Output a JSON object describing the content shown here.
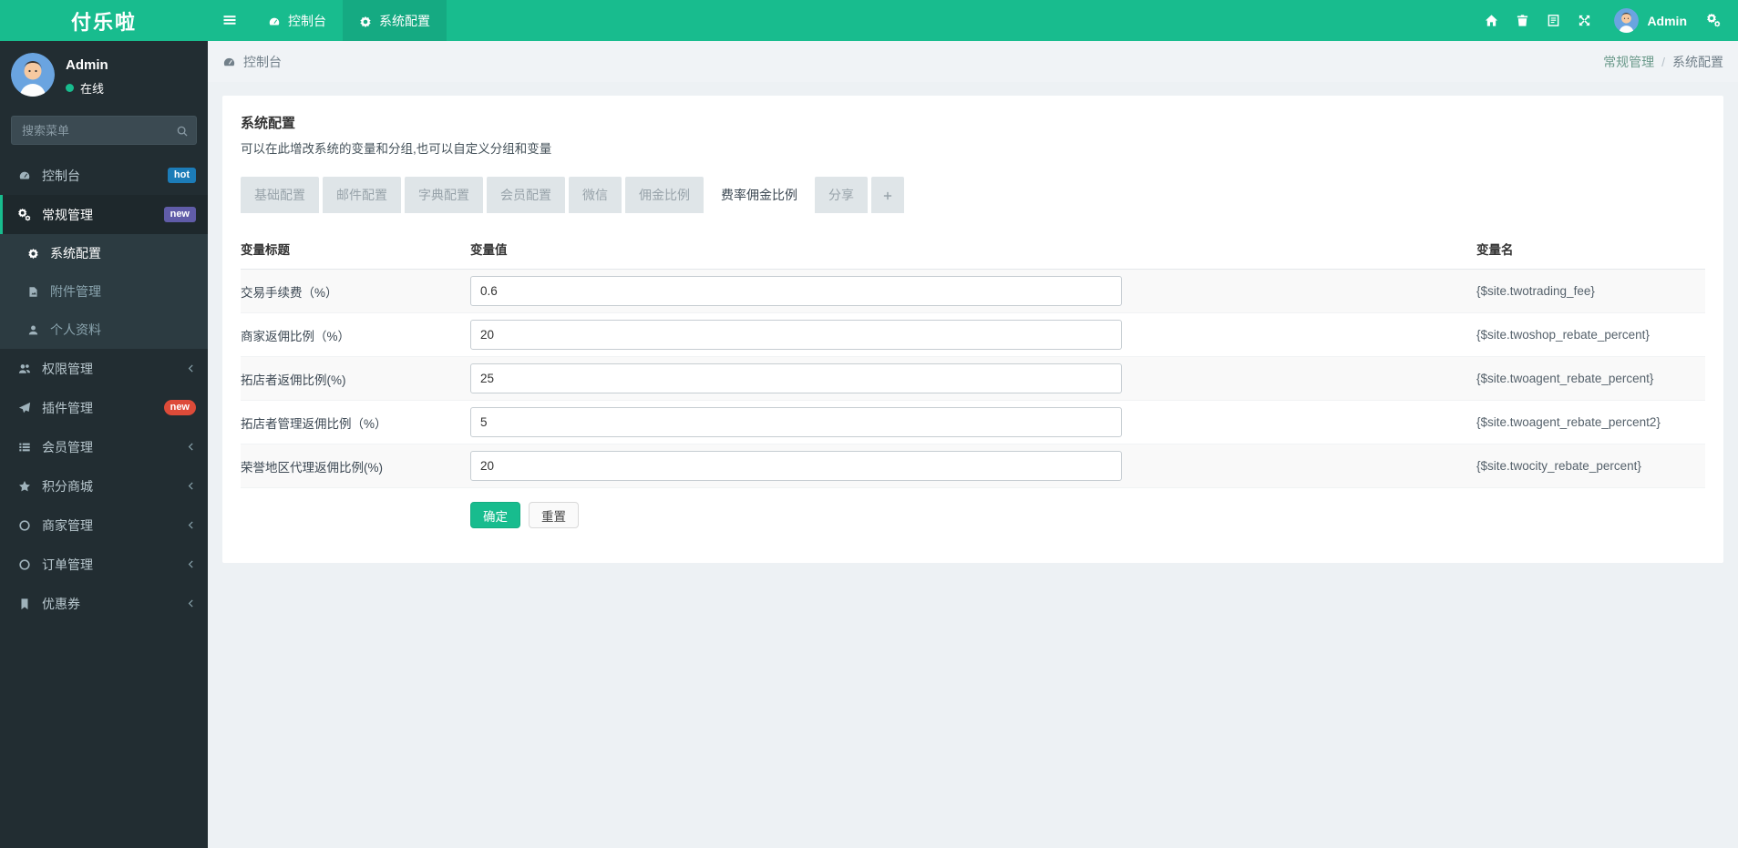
{
  "app": {
    "logo": "付乐啦"
  },
  "topnav": {
    "items": [
      {
        "label": "控制台",
        "icon": "tachometer",
        "active": false
      },
      {
        "label": "系统配置",
        "icon": "gear",
        "active": true
      }
    ],
    "right_icons": [
      {
        "name": "home-icon",
        "icon": "home"
      },
      {
        "name": "trash-icon",
        "icon": "trash"
      },
      {
        "name": "manual-icon",
        "icon": "book"
      },
      {
        "name": "fullscreen-icon",
        "icon": "expand"
      }
    ],
    "user": {
      "name": "Admin"
    },
    "after_user_icon": {
      "name": "cogs-icon",
      "icon": "cogs"
    }
  },
  "sidebar": {
    "user": {
      "name": "Admin",
      "status": "在线"
    },
    "search_placeholder": "搜索菜单",
    "items": [
      {
        "label": "控制台",
        "icon": "tachometer",
        "badge": {
          "text": "hot",
          "type": "blue"
        }
      },
      {
        "label": "常规管理",
        "icon": "cogs",
        "badge": {
          "text": "new",
          "type": "purple"
        },
        "active": true,
        "children": [
          {
            "label": "系统配置",
            "icon": "gear",
            "active": true
          },
          {
            "label": "附件管理",
            "icon": "file"
          },
          {
            "label": "个人资料",
            "icon": "user"
          }
        ]
      },
      {
        "label": "权限管理",
        "icon": "users",
        "chevron": true
      },
      {
        "label": "插件管理",
        "icon": "plane",
        "badge": {
          "text": "new",
          "type": "red"
        }
      },
      {
        "label": "会员管理",
        "icon": "list",
        "chevron": true
      },
      {
        "label": "积分商城",
        "icon": "star",
        "chevron": true
      },
      {
        "label": "商家管理",
        "icon": "circle",
        "chevron": true
      },
      {
        "label": "订单管理",
        "icon": "circle",
        "chevron": true
      },
      {
        "label": "优惠券",
        "icon": "bookmark",
        "chevron": true
      }
    ]
  },
  "breadcrumb": {
    "left": "控制台",
    "section": "常规管理",
    "separator": "/",
    "page": "系统配置"
  },
  "panel": {
    "title": "系统配置",
    "subtitle": "可以在此增改系统的变量和分组,也可以自定义分组和变量",
    "tabs": [
      {
        "label": "基础配置"
      },
      {
        "label": "邮件配置"
      },
      {
        "label": "字典配置"
      },
      {
        "label": "会员配置"
      },
      {
        "label": "微信"
      },
      {
        "label": "佣金比例"
      },
      {
        "label": "费率佣金比例",
        "active": true
      },
      {
        "label": "分享"
      },
      {
        "label": "+",
        "is_add": true
      }
    ],
    "table": {
      "headers": [
        "变量标题",
        "变量值",
        "变量名"
      ],
      "rows": [
        {
          "label": "交易手续费（%）",
          "value": "0.6",
          "name": "{$site.twotrading_fee}"
        },
        {
          "label": "商家返佣比例（%）",
          "value": "20",
          "name": "{$site.twoshop_rebate_percent}"
        },
        {
          "label": "拓店者返佣比例(%)",
          "value": "25",
          "name": "{$site.twoagent_rebate_percent}"
        },
        {
          "label": "拓店者管理返佣比例（%）",
          "value": "5",
          "name": "{$site.twoagent_rebate_percent2}"
        },
        {
          "label": "荣誉地区代理返佣比例(%)",
          "value": "20",
          "name": "{$site.twocity_rebate_percent}"
        }
      ]
    },
    "buttons": {
      "ok": "确定",
      "reset": "重置"
    }
  },
  "colors": {
    "accent": "#18bc8e",
    "navbar_active": "#15aa82",
    "sidebar_bg": "#222d32",
    "submenu_bg": "#2c3b41",
    "badge_blue": "#1c7cb8",
    "badge_purple": "#605ca8",
    "badge_red": "#dd4b39",
    "stripe_row": "#f9f9f9"
  }
}
